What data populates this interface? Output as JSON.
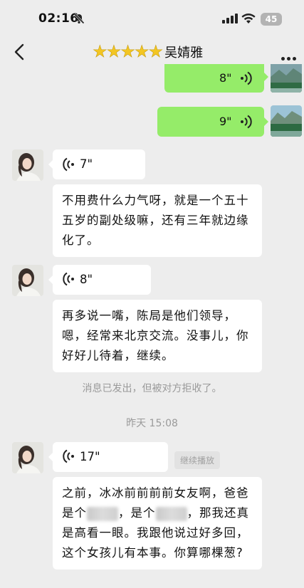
{
  "status_bar": {
    "time": "02:16",
    "battery": "45"
  },
  "chat": {
    "contact_name": "吴婧雅",
    "title_stars": "★★★★★"
  },
  "messages": {
    "out_voice_1": {
      "duration": "8\""
    },
    "out_voice_2": {
      "duration": "9\""
    },
    "in_voice_1": {
      "duration": "7\""
    },
    "in_text_1": {
      "text": "不用费什么力气呀，就是一个五十五岁的副处级嘛，还有三年就边缘化了。"
    },
    "in_voice_2": {
      "duration": "8\""
    },
    "in_text_2": {
      "text": "再多说一嘴，陈局是他们领导，嗯，经常来北京交流。没事儿，你好好儿待着，继续。"
    },
    "system_rejected": "消息已发出，但被对方拒收了。",
    "timestamp": "昨天 15:08",
    "in_voice_3": {
      "duration": "17\"",
      "continue_label": "继续播放"
    },
    "in_text_3": {
      "part1": "之前，冰冰前前前前女友啊，爸爸是个",
      "part2": "，是个",
      "part3": "，那我还真是高看一眼。我跟他说过好多回，这个女孩儿有本事。你算哪棵葱?"
    }
  },
  "icons": {
    "back": "chevron-left-icon",
    "more": "more-dots-icon",
    "voice": "voice-wave-icon",
    "mute": "bell-slash-icon"
  },
  "colors": {
    "background": "#ededed",
    "outgoing_bubble": "#95ec69",
    "incoming_bubble": "#ffffff",
    "system_text": "#9a9a9a",
    "stars": "#f3c623"
  }
}
